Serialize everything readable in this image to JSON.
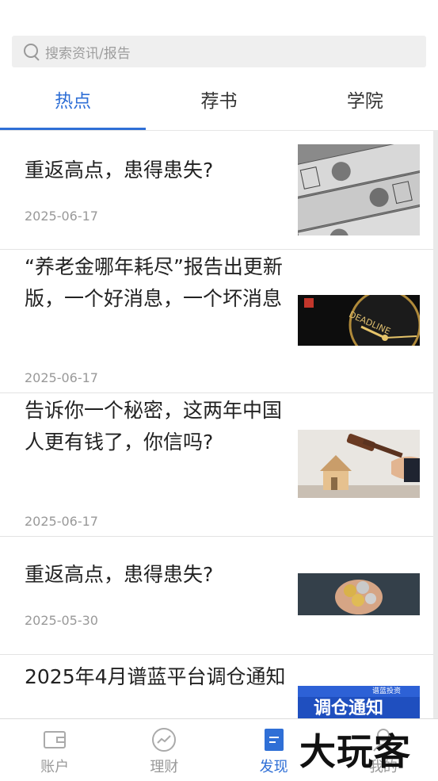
{
  "search": {
    "placeholder": "搜索资讯/报告"
  },
  "tabs": [
    {
      "label": "热点",
      "active": true
    },
    {
      "label": "荐书",
      "active": false
    },
    {
      "label": "学院",
      "active": false
    }
  ],
  "articles": [
    {
      "title": "重返高点，患得患失?",
      "date": "2025-06-17",
      "thumb": "dollar-bills-image"
    },
    {
      "title": "“养老金哪年耗尽”报告出更新版，一个好消息，一个坏消息",
      "date": "2025-06-17",
      "thumb": "deadline-clock-image"
    },
    {
      "title": "告诉你一个秘密，这两年中国人更有钱了，你信吗?",
      "date": "2025-06-17",
      "thumb": "auction-gavel-house-image"
    },
    {
      "title": "重返高点，患得患失?",
      "date": "2025-05-30",
      "thumb": "coins-in-hands-image"
    },
    {
      "title": "2025年4月谱蓝平台调仓通知",
      "date": "",
      "thumb": "rebalance-notice-image",
      "thumb_text": "调仓通知",
      "thumb_small": "谱蓝",
      "thumb_small2": "投资"
    }
  ],
  "tabbar": [
    {
      "label": "账户",
      "icon": "wallet-icon",
      "active": false
    },
    {
      "label": "理财",
      "icon": "chart-trend-icon",
      "active": false
    },
    {
      "label": "发现",
      "icon": "document-icon",
      "active": true
    },
    {
      "label": "我的",
      "icon": "person-icon",
      "active": false
    }
  ],
  "watermark": "大玩客",
  "colors": {
    "accent": "#2f6fd6"
  }
}
